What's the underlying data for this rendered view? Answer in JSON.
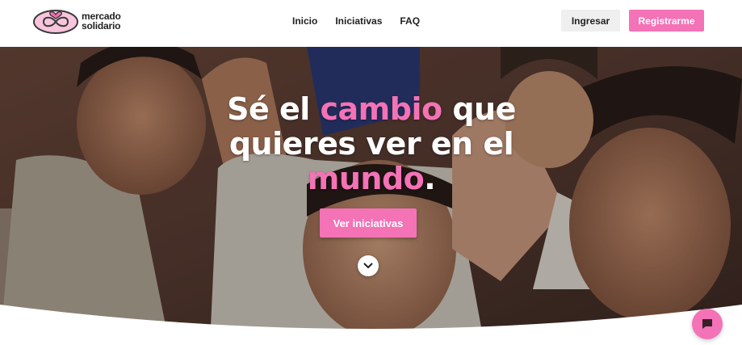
{
  "brand": {
    "line1": "mercado",
    "line2": "solidario",
    "logo_icon": "heart-infinity-icon",
    "color": "#f472b6"
  },
  "nav": {
    "items": [
      {
        "label": "Inicio"
      },
      {
        "label": "Iniciativas"
      },
      {
        "label": "FAQ"
      }
    ]
  },
  "auth": {
    "login_label": "Ingresar",
    "register_label": "Registrarme"
  },
  "hero": {
    "title_part1": "Sé el ",
    "title_accent1": "cambio",
    "title_part2": " que quieres ver en el ",
    "title_accent2": "mundo",
    "title_part3": ".",
    "cta_label": "Ver iniciativas",
    "scroll_icon": "chevron-down-icon",
    "background": "photo of smiling children"
  },
  "chat": {
    "icon": "chat-bubble-icon"
  }
}
